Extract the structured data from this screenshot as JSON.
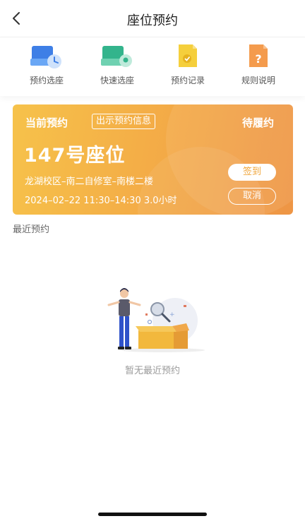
{
  "nav": {
    "title": "座位预约"
  },
  "shortcuts": [
    {
      "label": "预约选座",
      "icon": "calendar-seat-icon"
    },
    {
      "label": "快速选座",
      "icon": "quick-seat-icon"
    },
    {
      "label": "预约记录",
      "icon": "record-icon"
    },
    {
      "label": "规则说明",
      "icon": "rules-icon"
    }
  ],
  "current": {
    "label": "当前预约",
    "info_button": "出示预约信息",
    "status": "待履约",
    "seat": "147号座位",
    "location": "龙湖校区–南二自修室–南楼二楼",
    "datetime": "2024–02–22   11:30–14:30   3.0小时",
    "checkin": "签到",
    "cancel": "取消"
  },
  "recent": {
    "title": "最近预约",
    "empty_text": "暂无最近预约"
  },
  "colors": {
    "card_start": "#f6c24a",
    "card_end": "#ee9545",
    "accent_blue": "#4a8ff0",
    "accent_green": "#4cc5a0",
    "accent_yellow": "#f5cf3c",
    "accent_orange": "#f49b4d"
  }
}
